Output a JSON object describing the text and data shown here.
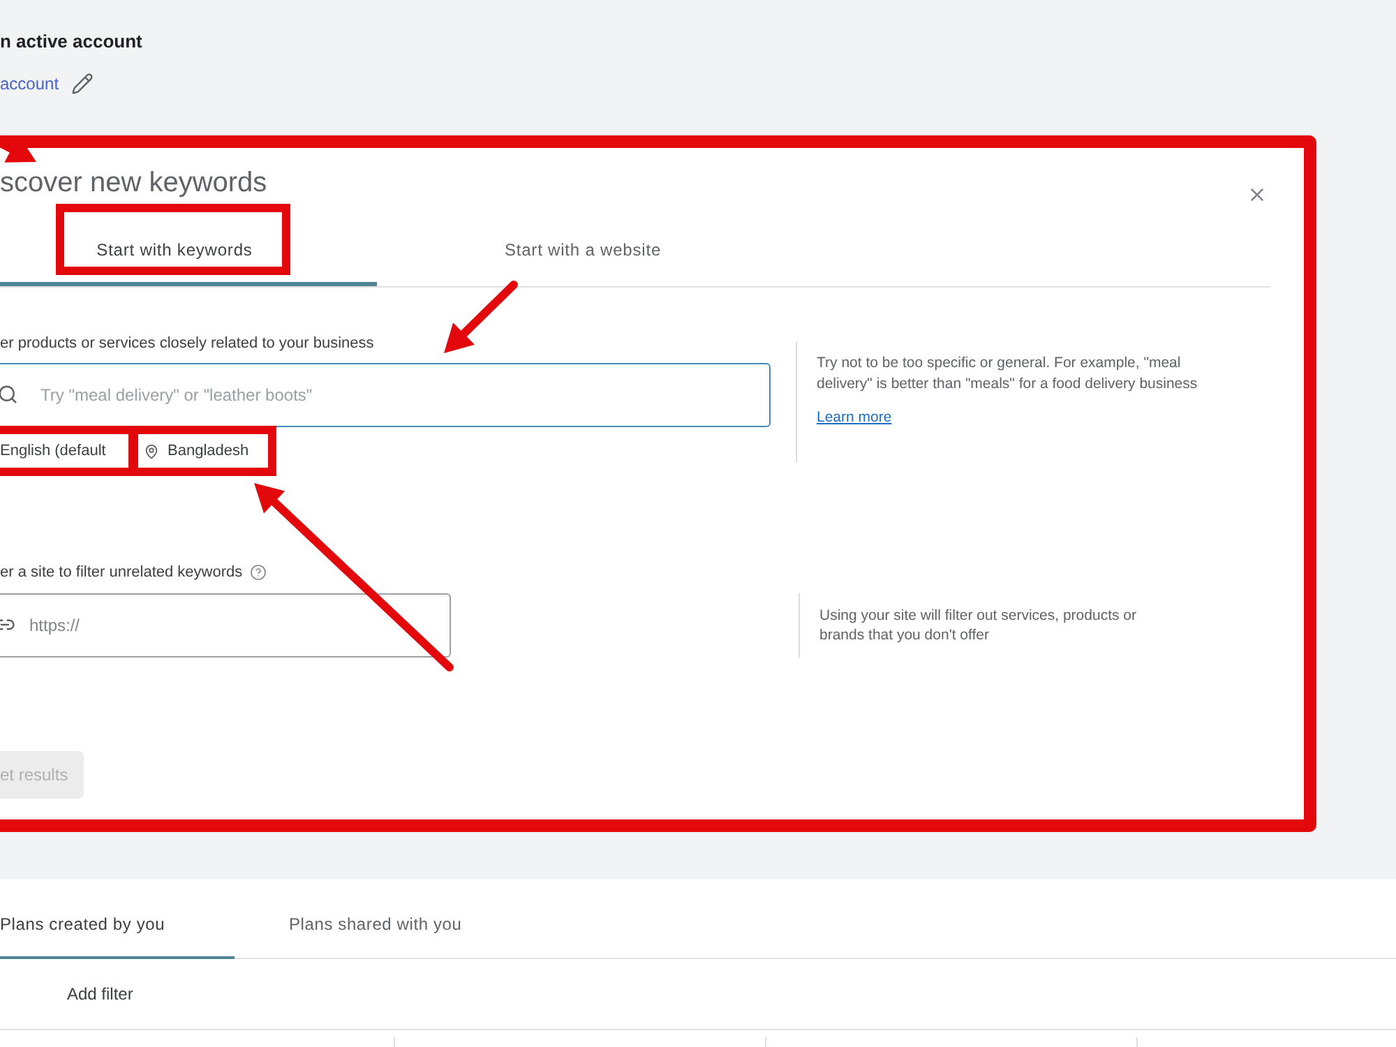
{
  "account": {
    "heading": "n active account",
    "link": "account"
  },
  "dialog": {
    "title": "scover new keywords",
    "tabs": [
      {
        "label": "Start with keywords",
        "selected": true
      },
      {
        "label": "Start with a website",
        "selected": false
      }
    ],
    "keywords": {
      "label": "er products or services closely related to your business",
      "placeholder": "Try \"meal delivery\" or \"leather boots\"",
      "focused": true,
      "language": "English (default",
      "location": "Bangladesh",
      "hint": "Try not to be too specific or general. For example, \"meal delivery\" is better than \"meals\" for a food delivery business",
      "hint_link": "Learn more"
    },
    "site": {
      "label": "er a site to filter unrelated keywords",
      "placeholder": "https://",
      "focused": false,
      "hint": "Using your site will filter out services, products or brands that you don't offer"
    },
    "submit": {
      "label": "et results",
      "disabled": true
    }
  },
  "plans": {
    "tabs": [
      {
        "label": "Plans created by you",
        "selected": true
      },
      {
        "label": "Plans shared with you",
        "selected": false
      }
    ],
    "filter": "Add filter"
  }
}
